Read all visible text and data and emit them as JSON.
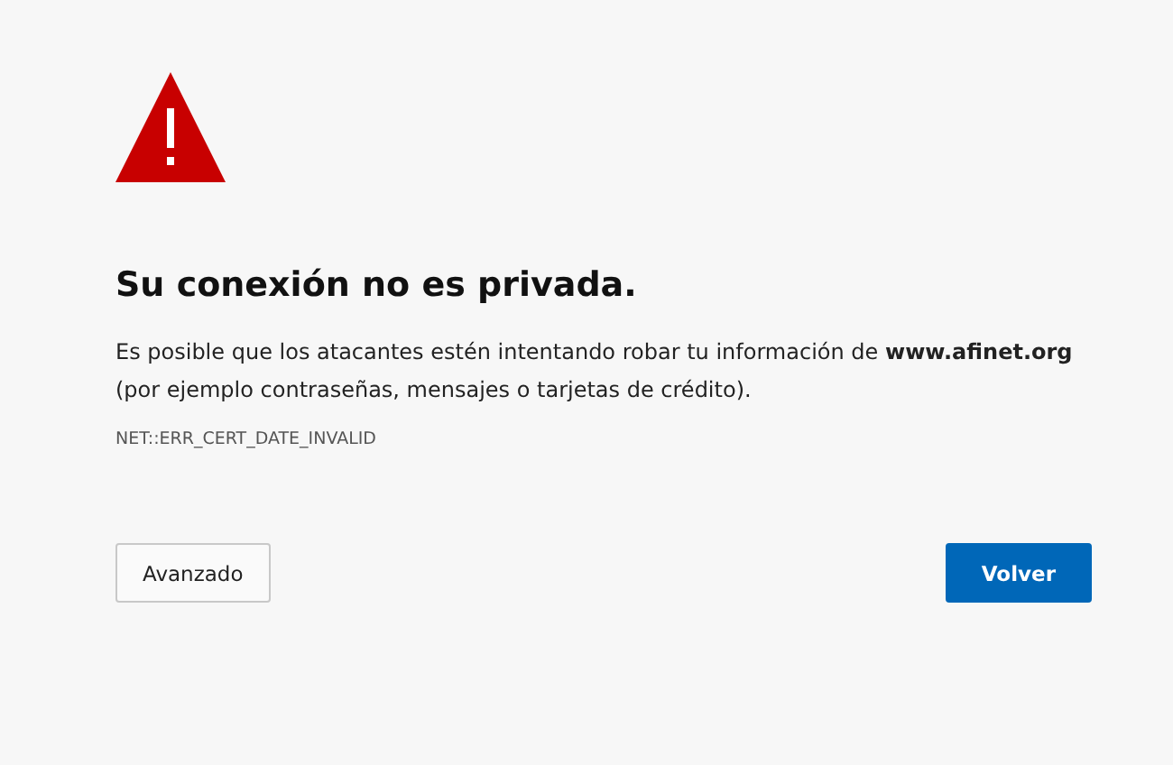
{
  "heading": "Su conexión no es privada.",
  "message": "Es posible que los atacantes estén intentando robar tu información de **www.afinet.org** (por ejemplo contraseñas, mensajes o tarjetas de crédito).",
  "error_code": "NET::ERR_CERT_DATE_INVALID",
  "buttons": [
    {
      "label": "Avanzado",
      "kind": "secondary"
    },
    {
      "label": "Volver",
      "kind": "primary"
    }
  ]
}
